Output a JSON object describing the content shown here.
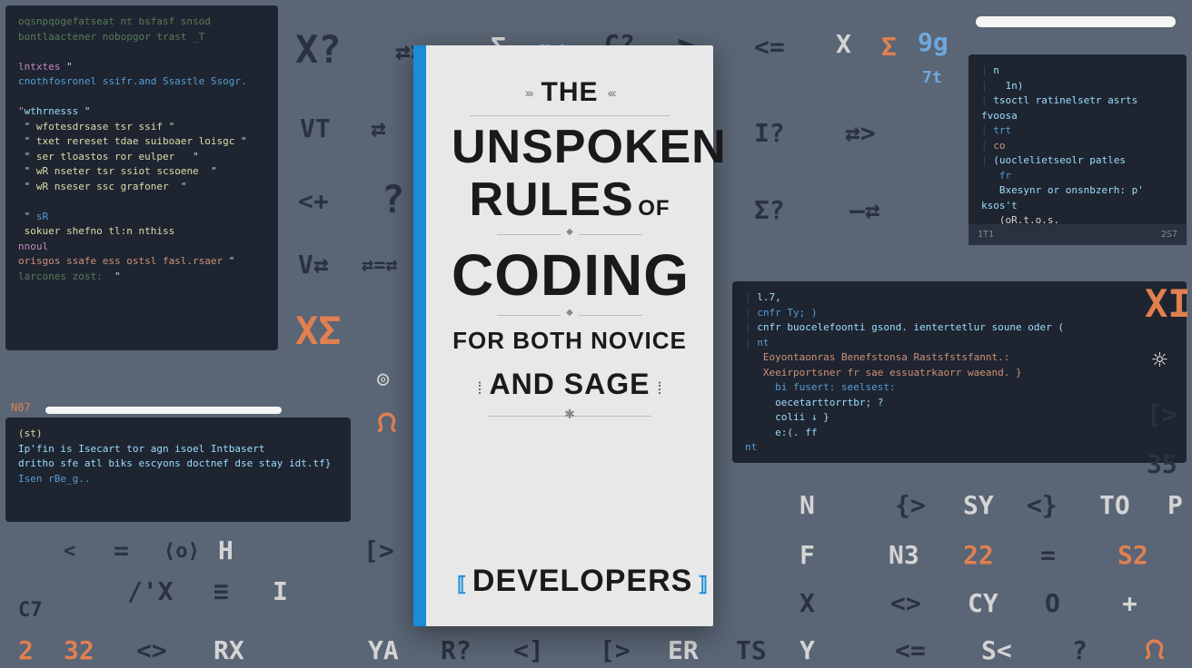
{
  "book": {
    "the": "THE",
    "unspoken": "UNSPOKEN",
    "rules": "RULES",
    "of": "OF",
    "coding": "CODING",
    "forboth": "FOR BOTH NOVICE",
    "and": "AND SAGE",
    "developers": "DEVELOPERS"
  },
  "panel3_footer": {
    "left": "1T1",
    "right": "2S7"
  },
  "panel2_label": "N07",
  "symbols": {
    "r1": [
      "X?",
      "⇄>",
      "Σ",
      "g⇄",
      "C?",
      ">",
      "<=",
      "X",
      "Σ",
      "9g"
    ],
    "r1b": "7t",
    "r2": [
      "VT",
      "⇄"
    ],
    "r3": [
      "<+",
      "?"
    ],
    "r4": [
      "V⇄",
      "⇄=⇄"
    ],
    "r5": [
      "XΣ"
    ],
    "r6": "◎",
    "r7": "ᙁ",
    "r8": [
      "I?",
      "⇄>"
    ],
    "r9": [
      "Σ?",
      "—⇄"
    ],
    "r10": "XI",
    "r11": [
      "☼",
      "[>",
      "35"
    ],
    "bot1": [
      "<",
      "=",
      "⟨o⟩",
      "H",
      "[>"
    ],
    "bot2": [
      "/'X",
      "≡",
      "I"
    ],
    "bot3": [
      "C7"
    ],
    "bot4": [
      "2",
      "32",
      "<>",
      "RX"
    ],
    "bot5": [
      "YA",
      "R?",
      "<]",
      "[>",
      "ER",
      "TS",
      "Y"
    ],
    "grid": [
      [
        "N",
        "{>",
        "SY",
        "<}",
        "TO",
        "P"
      ],
      [
        "F",
        "N3",
        "22",
        "=",
        "S2"
      ],
      [
        "X",
        "<>",
        "CY",
        "O",
        "+"
      ],
      [
        "<=",
        "S<",
        "?",
        "ᙁ"
      ]
    ]
  },
  "code1": {
    "l1": "oqsnpqogefatseat nt bsfasf snsod",
    "l2": "bontlaactener nobopgor trast _T",
    "l3": "lntxtes",
    "l4": "cnothfosronel ssifr.and Ssastle Ssogr.",
    "l5": "wthrnesss",
    "l6": "wfotesdrsase tsr ssif",
    "l7": "txet rereset tdae suiboaer loisgc",
    "l8": "ser tloastos ror eulper",
    "l9": "wR nseter tsr ssiot scsoene",
    "l10": "wR nseser ssc grafoner",
    "l11": "sR",
    "l12": "sokuer shefno tl:n nthiss",
    "l13": "nnoul",
    "l14": "orisgos ssafe ess ostsl fasl.rsaer",
    "l15": "larcones zost:"
  },
  "code2": {
    "l1": "(st)",
    "l2": "Ip'fin is Isecart tor agn isoel Intbasert",
    "l3": "dritho sfe atl biks escyons doctnef dse stay idt.tf}",
    "l4": "Isen rBe_g.."
  },
  "code3": {
    "l1": "n",
    "l2": "1n)",
    "l3": "tsoctl ratinelsetr asrts fvoosa",
    "l4": "trt",
    "l5": "co",
    "l6": "(uoclelietseolr patles",
    "l7": "fr",
    "l8": "Bxesynr or onsnbzerh: p' ksos't",
    "l9": "(oR.t.o.s."
  },
  "code4": {
    "l1": "l.7,",
    "l2": "cnfr   Ty;   )",
    "l3": "cnfr buocelefoonti gsond. ientertetlur soune oder   (",
    "l4": "nt",
    "l5": "Eoyontaonras Benefstonsa Rastsfstsfannt.:",
    "l6": "Xeeirportsner fr sae essuatrkaorr waeand. }",
    "l7": "bi fusert: seelsest:",
    "l8": "oecetarttorrtbr;    ?",
    "l9": "colii ↓     }",
    "l10": "e:(. ff",
    "l11": "nt"
  }
}
